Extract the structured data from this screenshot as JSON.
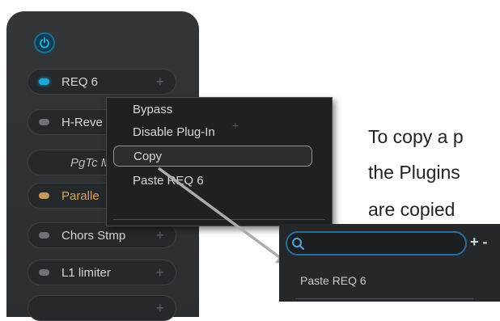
{
  "rack": {
    "power_icon": "power-icon",
    "slots": [
      {
        "label": "REQ 6",
        "led": "blue",
        "plus": "+"
      },
      {
        "label": "H-Reve",
        "led": "gray",
        "plus": "+"
      },
      {
        "label": "PgTc M",
        "led": "none",
        "plus": ""
      },
      {
        "label": "Paralle",
        "led": "amber",
        "plus": ""
      },
      {
        "label": "Chors Stmp",
        "led": "gray",
        "plus": "+"
      },
      {
        "label": "L1 limiter",
        "led": "gray",
        "plus": "+"
      },
      {
        "label": "",
        "led": "none",
        "plus": "+"
      }
    ]
  },
  "context_menu": {
    "items": [
      "Bypass",
      "Disable Plug-In",
      "Copy",
      "Paste REQ 6"
    ],
    "highlighted": "Copy",
    "ghost_plus": "+"
  },
  "caption": {
    "line1": "To copy a p",
    "line2": "the Plugins",
    "line3": "are copied"
  },
  "plugins_panel": {
    "search_icon": "search-icon",
    "search_value": "",
    "add_remove": "+ -",
    "paste_label": "Paste REQ 6"
  },
  "colors": {
    "accent": "#1ea7d6",
    "amber": "#c69a58",
    "panel_bg": "#2c2f32"
  }
}
